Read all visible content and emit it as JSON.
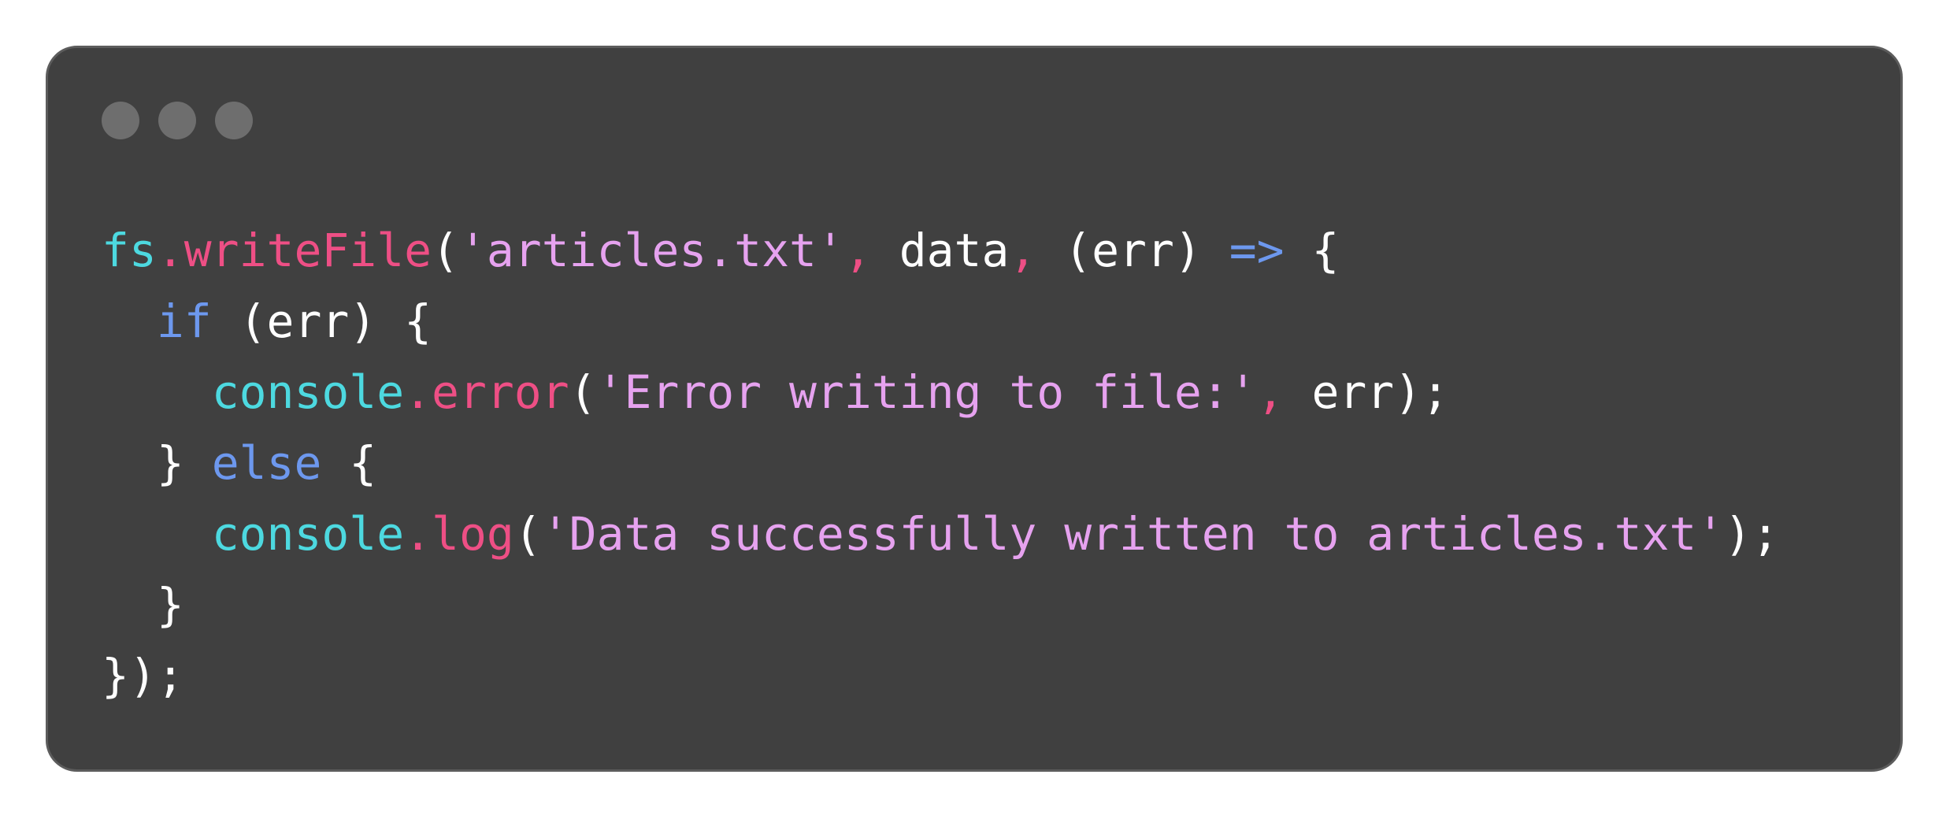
{
  "colors": {
    "page_background": "#ffffff",
    "window_background": "#404040",
    "window_dot": "#6e6e6e",
    "object": "#4dd9e0",
    "method": "#ee4f85",
    "string": "#e6a2ef",
    "keyword": "#6d98ee",
    "plain": "#ffffff"
  },
  "window": {
    "dots": [
      "window-dot",
      "window-dot",
      "window-dot"
    ]
  },
  "code": {
    "lines": [
      {
        "tokens": [
          {
            "text": "fs",
            "kind": "obj"
          },
          {
            "text": ".writeFile",
            "kind": "fn"
          },
          {
            "text": "(",
            "kind": "plain"
          },
          {
            "text": "'articles.txt'",
            "kind": "str"
          },
          {
            "text": ", ",
            "kind": "fn"
          },
          {
            "text": "data",
            "kind": "plain"
          },
          {
            "text": ", ",
            "kind": "fn"
          },
          {
            "text": "(err) ",
            "kind": "plain"
          },
          {
            "text": "=>",
            "kind": "kw"
          },
          {
            "text": " {",
            "kind": "plain"
          }
        ]
      },
      {
        "tokens": [
          {
            "text": "  ",
            "kind": "plain"
          },
          {
            "text": "if",
            "kind": "kw"
          },
          {
            "text": " (err) {",
            "kind": "plain"
          }
        ]
      },
      {
        "tokens": [
          {
            "text": "    ",
            "kind": "plain"
          },
          {
            "text": "console",
            "kind": "obj"
          },
          {
            "text": ".error",
            "kind": "fn"
          },
          {
            "text": "(",
            "kind": "plain"
          },
          {
            "text": "'Error writing to file:'",
            "kind": "str"
          },
          {
            "text": ", ",
            "kind": "fn"
          },
          {
            "text": "err);",
            "kind": "plain"
          }
        ]
      },
      {
        "tokens": [
          {
            "text": "  } ",
            "kind": "plain"
          },
          {
            "text": "else",
            "kind": "kw"
          },
          {
            "text": " {",
            "kind": "plain"
          }
        ]
      },
      {
        "tokens": [
          {
            "text": "    ",
            "kind": "plain"
          },
          {
            "text": "console",
            "kind": "obj"
          },
          {
            "text": ".log",
            "kind": "fn"
          },
          {
            "text": "(",
            "kind": "plain"
          },
          {
            "text": "'Data successfully written to articles.txt'",
            "kind": "str"
          },
          {
            "text": ");",
            "kind": "plain"
          }
        ]
      },
      {
        "tokens": [
          {
            "text": "  }",
            "kind": "plain"
          }
        ]
      },
      {
        "tokens": [
          {
            "text": "});",
            "kind": "plain"
          }
        ]
      }
    ]
  }
}
